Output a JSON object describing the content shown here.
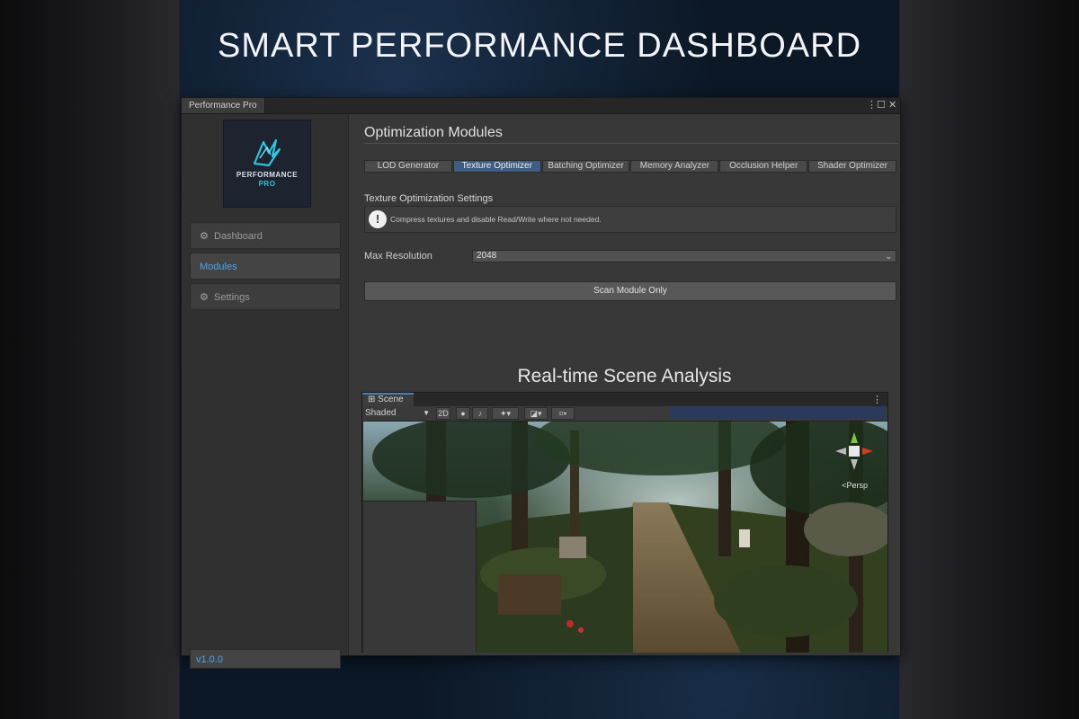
{
  "hero": {
    "title": "SMART PERFORMANCE DASHBOARD"
  },
  "window": {
    "title": "Performance Pro",
    "menu_icon": "⋮",
    "maximize_icon": "☐",
    "close_icon": "✕"
  },
  "logo": {
    "line1": "PERFORMANCE",
    "line2": "PRO"
  },
  "sidebar": {
    "items": [
      {
        "label": "Dashboard",
        "icon": "gear-icon",
        "active": false
      },
      {
        "label": "Modules",
        "icon": "",
        "active": true
      },
      {
        "label": "Settings",
        "icon": "gear-icon",
        "active": false
      }
    ],
    "version": "v1.0.0"
  },
  "main": {
    "section_title": "Optimization Modules",
    "tabs": [
      {
        "label": "LOD Generator",
        "active": false
      },
      {
        "label": "Texture Optimizer",
        "active": true
      },
      {
        "label": "Batching Optimizer",
        "active": false
      },
      {
        "label": "Memory Analyzer",
        "active": false
      },
      {
        "label": "Occlusion Helper",
        "active": false
      },
      {
        "label": "Shader Optimizer",
        "active": false
      }
    ],
    "settings_heading": "Texture Optimization Settings",
    "help_message": "Compress textures and disable Read/Write where not needed.",
    "max_resolution": {
      "label": "Max Resolution",
      "value": "2048"
    },
    "scan_button": "Scan Module Only",
    "analysis_title": "Real-time Scene Analysis"
  },
  "scene": {
    "tab_label": "Scene",
    "menu_icon": "⋮",
    "shading_mode": "Shaded",
    "toggle_2d": "2D",
    "gizmo_label": "Persp"
  },
  "colors": {
    "accent_blue": "#4ea3e6",
    "active_tab": "#3e5d80",
    "window_bg": "#383838",
    "logo_cyan": "#2fc4e0"
  }
}
